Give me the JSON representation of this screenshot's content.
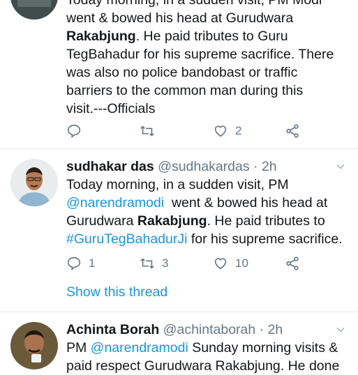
{
  "tweet1": {
    "text_lines": [
      {
        "pre": "Today morning, in a sudden visit, PM Modi",
        "bold": "",
        "post": ""
      },
      {
        "pre": "went & bowed his head at Gurudwara",
        "bold": "",
        "post": ""
      },
      {
        "pre": "",
        "bold": "Rakabjung",
        "post": ". He paid tributes to Guru"
      },
      {
        "pre": "TegBahadur for his supreme sacrifice. There",
        "bold": "",
        "post": ""
      },
      {
        "pre": "was also no police bandobast or traffic",
        "bold": "",
        "post": ""
      },
      {
        "pre": "barriers to the common man during this",
        "bold": "",
        "post": ""
      },
      {
        "pre": "visit.---Officials",
        "bold": "",
        "post": ""
      }
    ],
    "reply_count": "",
    "retweet_count": "",
    "like_count": "2"
  },
  "tweet2": {
    "name": "sudhakar das",
    "handle": "@sudhakardas",
    "time": " · 2h",
    "line1": "Today morning, in a sudden visit, PM",
    "mention": "@narendramodi",
    "line2_rest": "  went & bowed his head at",
    "line3_pre": "Gurudwara ",
    "line3_bold": "Rakabjung",
    "line3_post": ". He paid tributes to",
    "hashtag": "#GuruTegBahadurJi",
    "line4_post": " for his supreme sacrifice.",
    "reply_count": "1",
    "retweet_count": "3",
    "like_count": "10",
    "show_thread": "Show this thread"
  },
  "tweet3": {
    "name": "Achinta Borah",
    "handle": "@achintaborah",
    "time": " · 2h",
    "line1_pre": "PM ",
    "mention": "@narendramodi",
    "line1_post": " Sunday morning visits &",
    "line2": "paid respect Gurudwara Rakabjung. He done"
  },
  "colors": {
    "link": "#1b95e0",
    "muted": "#657786",
    "divider": "#e1e8ed"
  }
}
